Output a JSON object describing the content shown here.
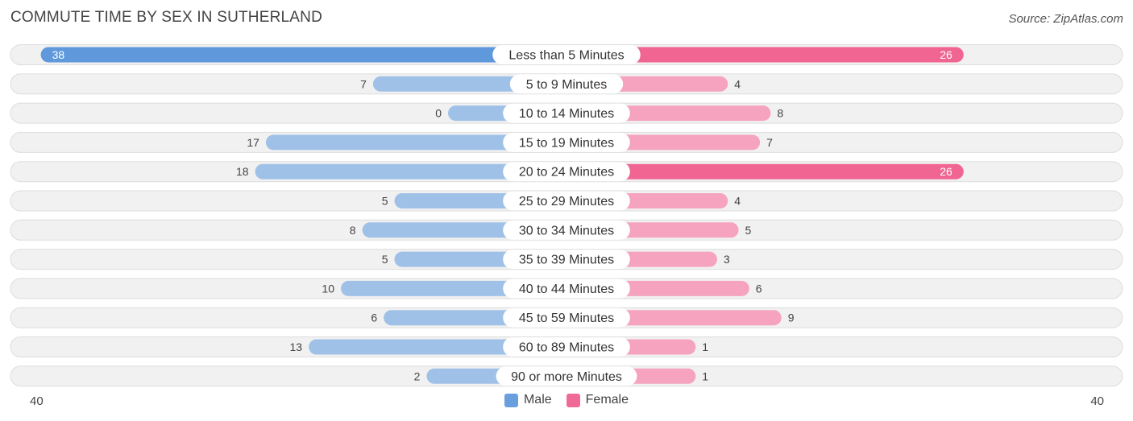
{
  "title": "COMMUTE TIME BY SEX IN SUTHERLAND",
  "source": "Source: ZipAtlas.com",
  "axis": {
    "left_label": "40",
    "right_label": "40"
  },
  "legend": [
    {
      "label": "Male",
      "color": "#6a9fdd"
    },
    {
      "label": "Female",
      "color": "#f06a97"
    }
  ],
  "colors": {
    "male_strong": "#5f98db",
    "male_light": "#9fc1e8",
    "female_strong": "#f06592",
    "female_light": "#f5a3bf",
    "row_bg": "#f1f1f1",
    "row_border": "#dddddd"
  },
  "chart_data": {
    "type": "bar",
    "orientation": "horizontal-diverging",
    "title": "COMMUTE TIME BY SEX IN SUTHERLAND",
    "xlim": [
      -40,
      40
    ],
    "categories": [
      "Less than 5 Minutes",
      "5 to 9 Minutes",
      "10 to 14 Minutes",
      "15 to 19 Minutes",
      "20 to 24 Minutes",
      "25 to 29 Minutes",
      "30 to 34 Minutes",
      "35 to 39 Minutes",
      "40 to 44 Minutes",
      "45 to 59 Minutes",
      "60 to 89 Minutes",
      "90 or more Minutes"
    ],
    "series": [
      {
        "name": "Male",
        "values": [
          38,
          7,
          0,
          17,
          18,
          5,
          8,
          5,
          10,
          6,
          13,
          2
        ]
      },
      {
        "name": "Female",
        "values": [
          26,
          4,
          8,
          7,
          26,
          4,
          5,
          3,
          6,
          9,
          1,
          1
        ]
      }
    ],
    "legend_position": "bottom-center"
  }
}
